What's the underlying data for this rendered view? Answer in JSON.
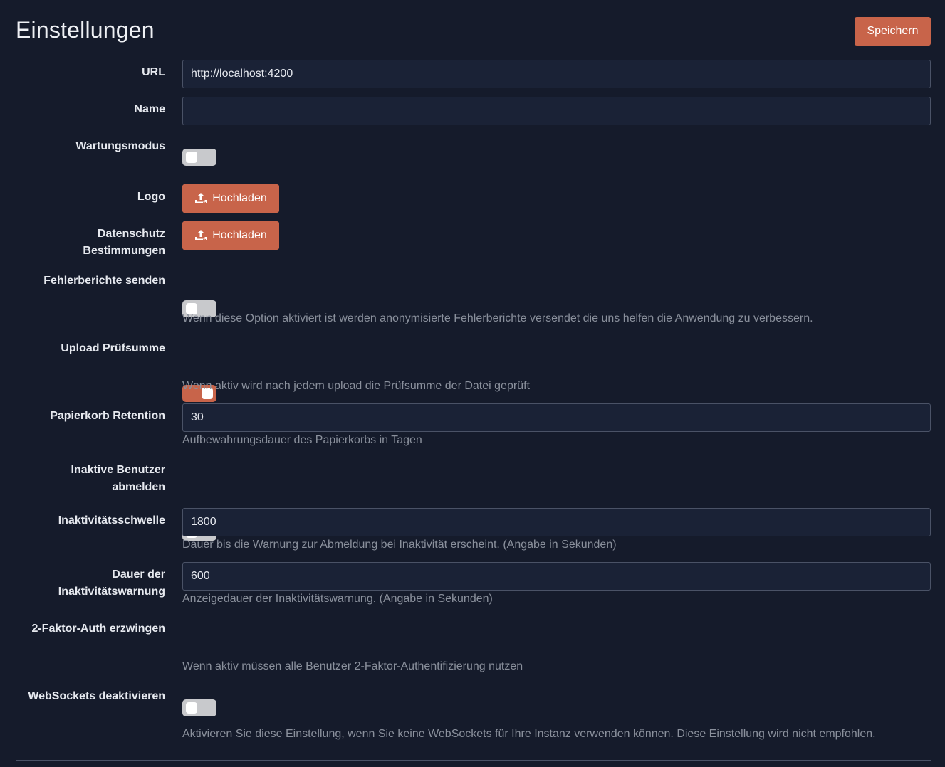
{
  "page": {
    "title": "Einstellungen",
    "save_label": "Speichern"
  },
  "fields": {
    "url": {
      "label": "URL",
      "value": "http://localhost:4200",
      "placeholder": ""
    },
    "name": {
      "label": "Name",
      "value": "",
      "placeholder": ""
    },
    "maintenance": {
      "label": "Wartungsmodus",
      "enabled": false
    },
    "logo": {
      "label": "Logo",
      "button": "Hochladen"
    },
    "privacy": {
      "label_line1": "Datenschutz",
      "label_line2": "Bestimmungen",
      "button": "Hochladen"
    },
    "error_reports": {
      "label": "Fehlerberichte senden",
      "enabled": false,
      "help": "Wenn diese Option aktiviert ist werden anonymisierte Fehlerberichte versendet die uns helfen die Anwendung zu verbessern."
    },
    "upload_checksum": {
      "label": "Upload Prüfsumme",
      "enabled": true,
      "help": "Wenn aktiv wird nach jedem upload die Prüfsumme der Datei geprüft"
    },
    "trash_retention": {
      "label": "Papierkorb Retention",
      "value": "30",
      "help": "Aufbewahrungsdauer des Papierkorbs in Tagen"
    },
    "logout_inactive": {
      "label_line1": "Inaktive Benutzer",
      "label_line2": "abmelden",
      "enabled": false
    },
    "inactivity_threshold": {
      "label": "Inaktivitätsschwelle",
      "value": "1800",
      "help": "Dauer bis die Warnung zur Abmeldung bei Inaktivität erscheint. (Angabe in Sekunden)"
    },
    "inactivity_warning": {
      "label_line1": "Dauer der",
      "label_line2": "Inaktivitätswarnung",
      "value": "600",
      "help": "Anzeigedauer der Inaktivitätswarnung. (Angabe in Sekunden)"
    },
    "force_2fa": {
      "label": "2-Faktor-Auth erzwingen",
      "enabled": false,
      "help": "Wenn aktiv müssen alle Benutzer 2-Faktor-Authentifizierung nutzen"
    },
    "disable_websockets": {
      "label": "WebSockets deaktivieren",
      "enabled": false,
      "help": "Aktivieren Sie diese Einstellung, wenn Sie keine WebSockets für Ihre Instanz verwenden können. Diese Einstellung wird nicht empfohlen."
    }
  },
  "colors": {
    "background": "#151b2b",
    "accent": "#c8644a",
    "input_bg": "#1a2236",
    "help_text": "#8a909c"
  },
  "icons": {
    "upload": "upload-icon"
  }
}
